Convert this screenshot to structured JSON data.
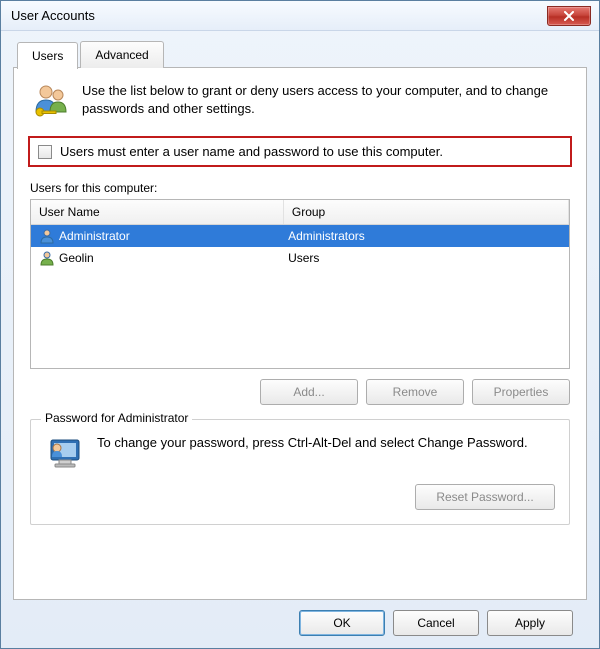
{
  "window": {
    "title": "User Accounts"
  },
  "tabs": {
    "users": "Users",
    "advanced": "Advanced"
  },
  "intro": "Use the list below to grant or deny users access to your computer, and to change passwords and other settings.",
  "require_login_label": "Users must enter a user name and password to use this computer.",
  "users_list": {
    "caption": "Users for this computer:",
    "headers": {
      "user": "User Name",
      "group": "Group"
    },
    "rows": [
      {
        "user": "Administrator",
        "group": "Administrators",
        "selected": true
      },
      {
        "user": "Geolin",
        "group": "Users",
        "selected": false
      }
    ]
  },
  "buttons": {
    "add": "Add...",
    "remove": "Remove",
    "properties": "Properties",
    "reset_pw": "Reset Password...",
    "ok": "OK",
    "cancel": "Cancel",
    "apply": "Apply"
  },
  "password_box": {
    "legend": "Password for Administrator",
    "text": "To change your password, press Ctrl-Alt-Del and select Change Password."
  }
}
